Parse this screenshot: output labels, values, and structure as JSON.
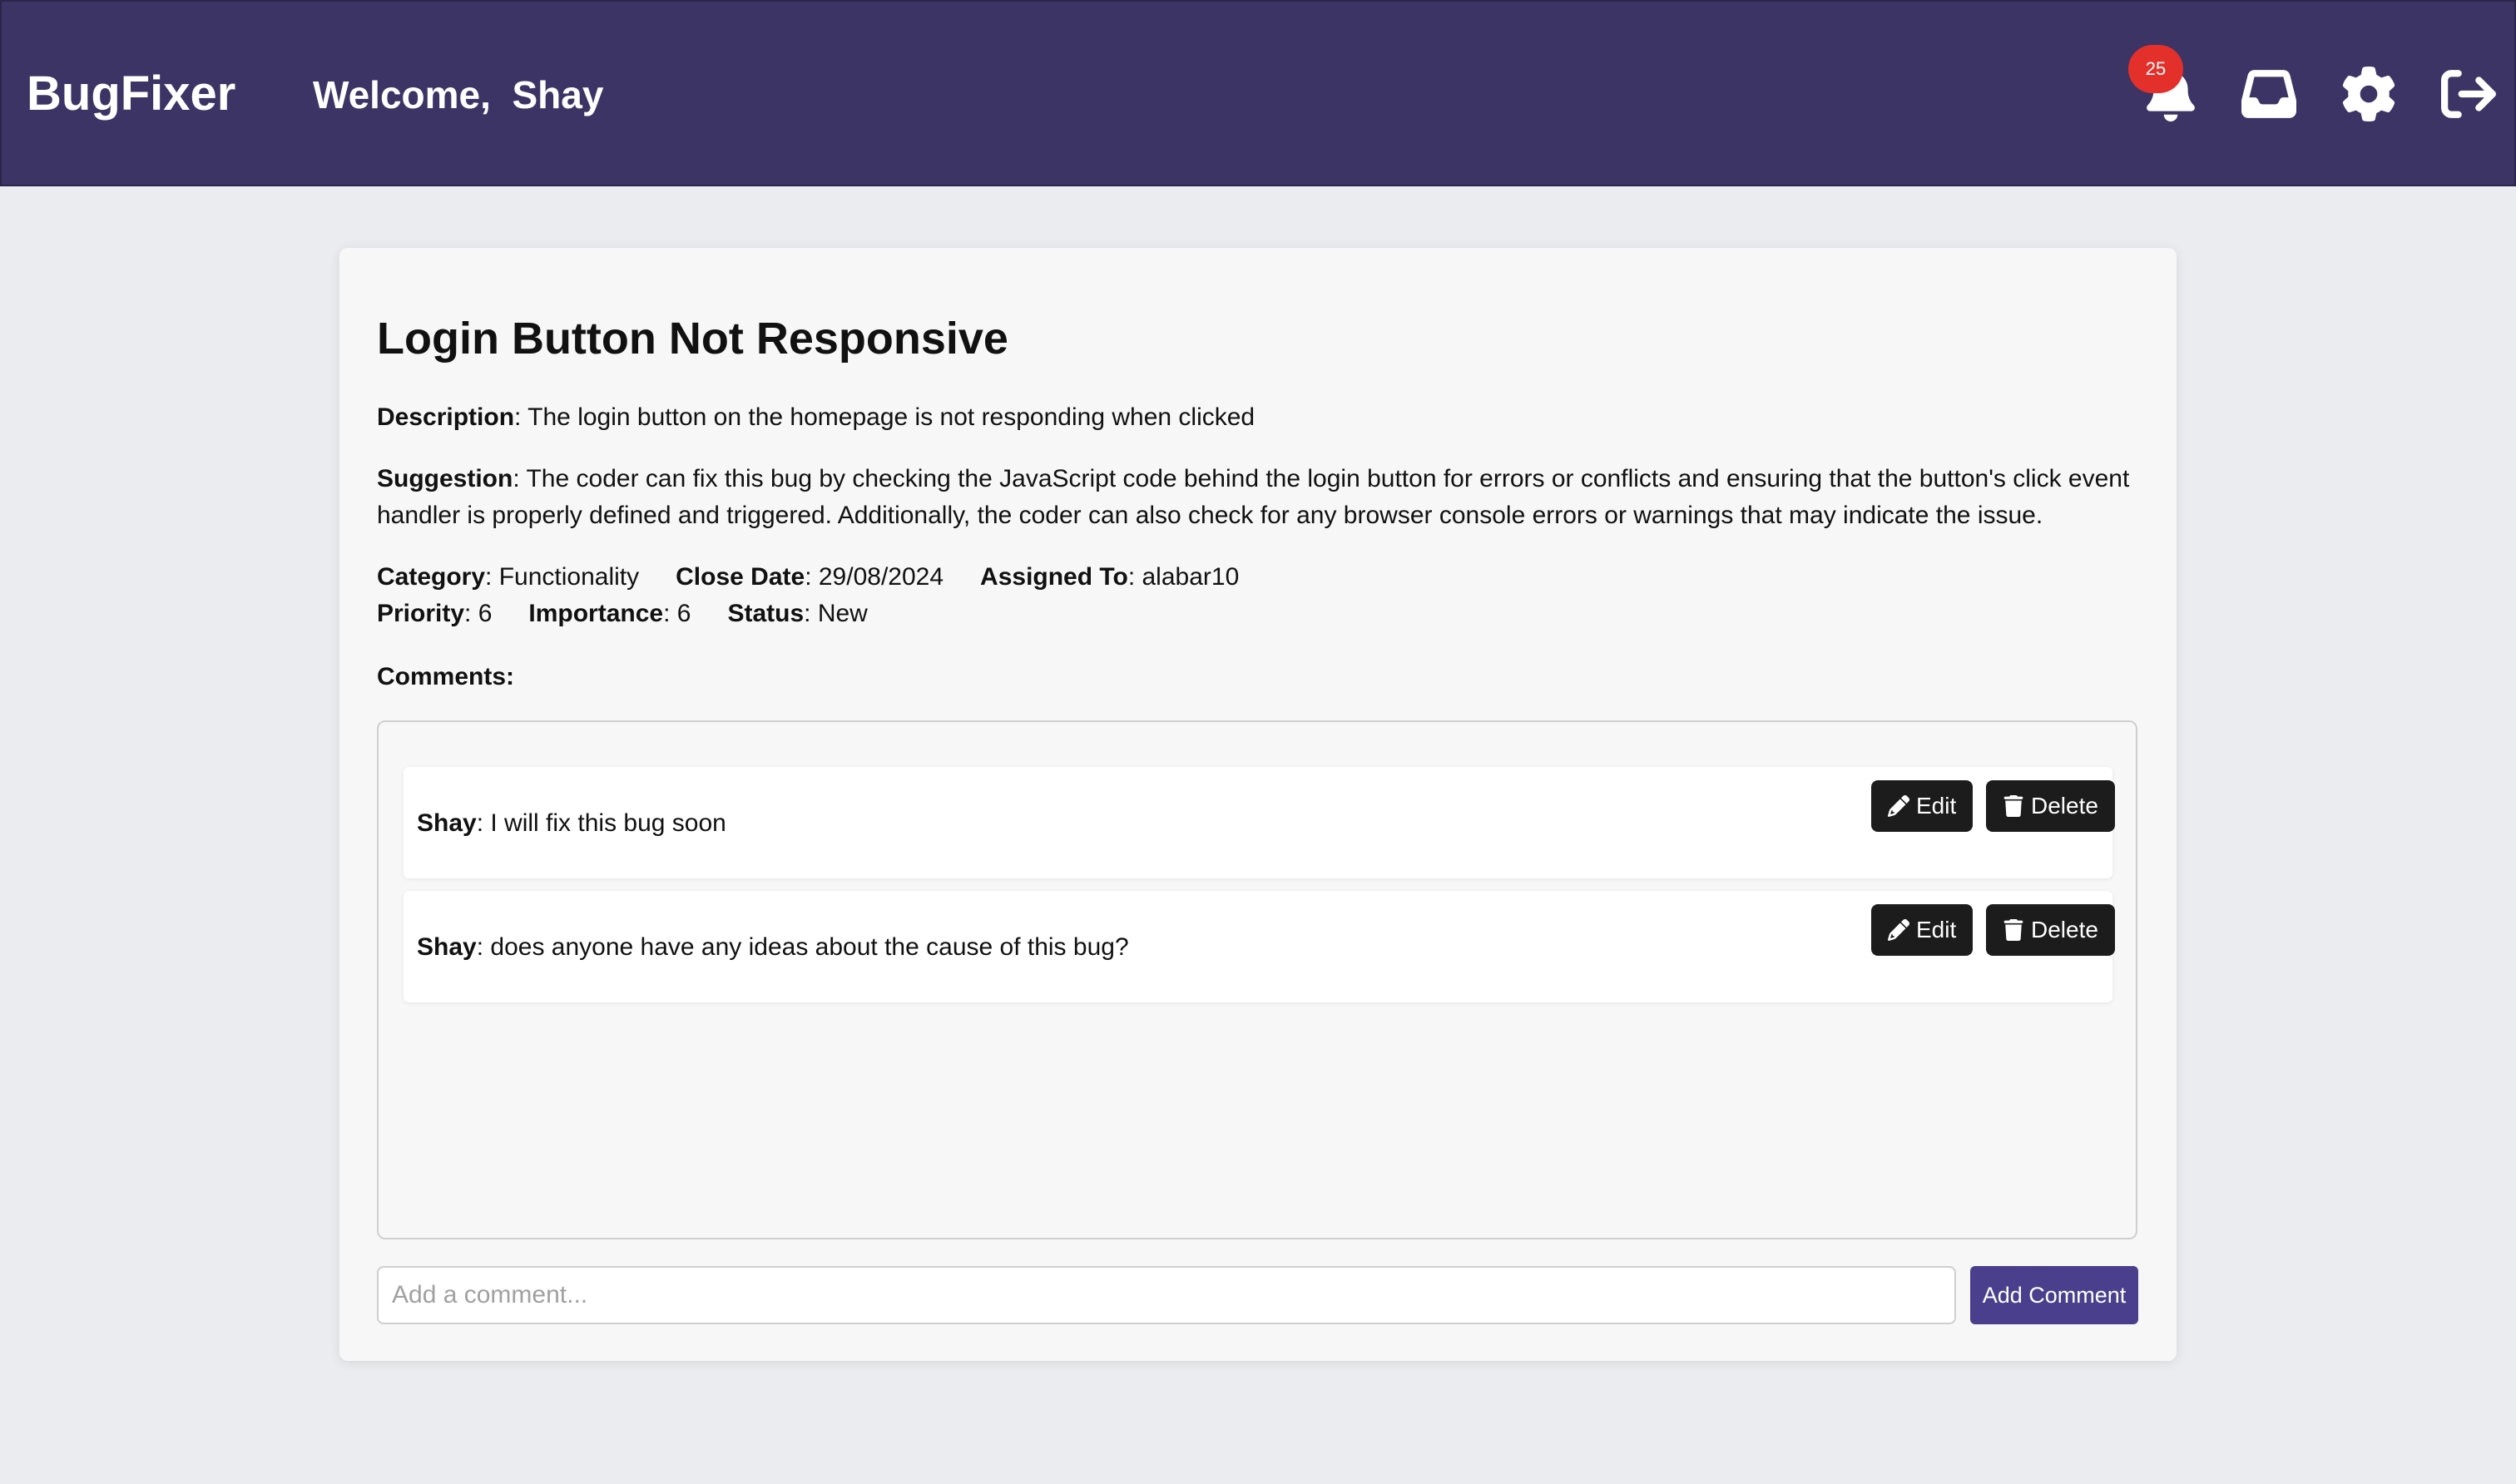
{
  "header": {
    "brand": "BugFixer",
    "welcome_prefix": "Welcome,",
    "user_name": "Shay",
    "notification_count": "25",
    "icons": [
      "bell-icon",
      "inbox-icon",
      "gear-icon",
      "logout-icon"
    ],
    "background_color": "#3c3464"
  },
  "bug": {
    "title": "Login Button Not Responsive",
    "description_label": "Description",
    "description": "The login button on the homepage is not responding when clicked",
    "suggestion_label": "Suggestion",
    "suggestion": "The coder can fix this bug by checking the JavaScript code behind the login button for errors or conflicts and ensuring that the button's click event handler is properly defined and triggered. Additionally, the coder can also check for any browser console errors or warnings that may indicate the issue.",
    "category_label": "Category",
    "category": "Functionality",
    "close_date_label": "Close Date",
    "close_date": "29/08/2024",
    "assigned_to_label": "Assigned To",
    "assigned_to": "alabar10",
    "priority_label": "Priority",
    "priority": "6",
    "importance_label": "Importance",
    "importance": "6",
    "status_label": "Status",
    "status": "New"
  },
  "comments": {
    "label": "Comments:",
    "items": [
      {
        "author": "Shay",
        "text": "I will fix this bug soon",
        "edit_label": "Edit",
        "delete_label": "Delete"
      },
      {
        "author": "Shay",
        "text": "does anyone have any ideas about the cause of this bug?",
        "edit_label": "Edit",
        "delete_label": "Delete"
      }
    ],
    "input_placeholder": "Add a comment...",
    "add_button_label": "Add Comment"
  },
  "colors": {
    "accent": "#4a3f8c",
    "badge": "#e4302b",
    "dark_button": "#1c1c1c"
  }
}
